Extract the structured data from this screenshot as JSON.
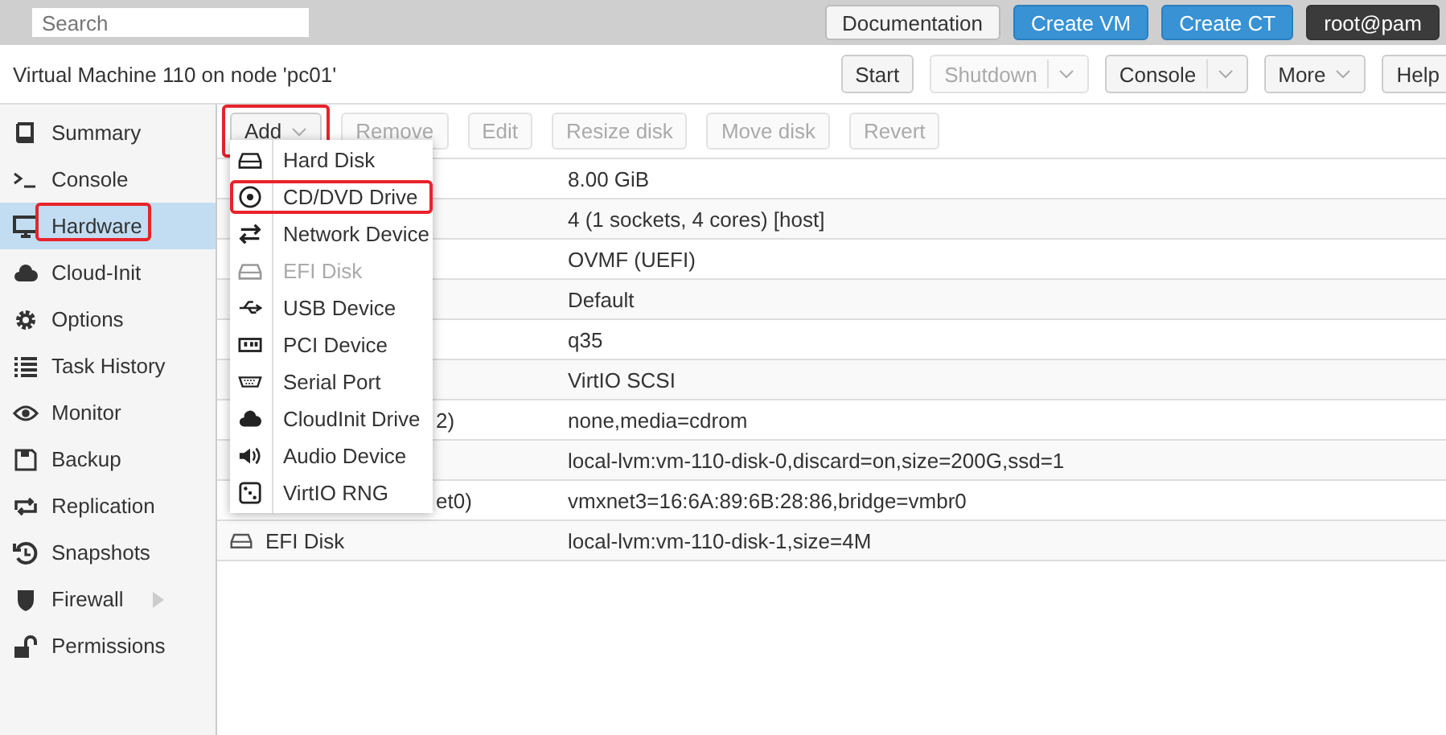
{
  "top_bar": {
    "search": {
      "placeholder": "Search"
    },
    "buttons": [
      {
        "label": "Documentation",
        "kind": "plain"
      },
      {
        "label": "Create VM",
        "kind": "primary"
      },
      {
        "label": "Create CT",
        "kind": "primary"
      },
      {
        "label": "root@pam",
        "kind": "user"
      }
    ]
  },
  "title": "Virtual Machine 110 on node 'pc01'",
  "header_buttons": [
    {
      "label": "Start",
      "disabled": false,
      "split": false,
      "caret": false
    },
    {
      "label": "Shutdown",
      "disabled": true,
      "split": true,
      "caret": true
    },
    {
      "label": "Console",
      "disabled": false,
      "split": true,
      "caret": true
    },
    {
      "label": "More",
      "disabled": false,
      "split": false,
      "caret": true
    },
    {
      "label": "Help",
      "disabled": false,
      "split": false,
      "caret": false
    }
  ],
  "sidebar": {
    "items": [
      {
        "label": "Summary",
        "selected": false,
        "annotated": false,
        "expandable": false
      },
      {
        "label": "Console",
        "selected": false,
        "annotated": false,
        "expandable": false
      },
      {
        "label": "Hardware",
        "selected": true,
        "annotated": true,
        "expandable": false
      },
      {
        "label": "Cloud-Init",
        "selected": false,
        "annotated": false,
        "expandable": false
      },
      {
        "label": "Options",
        "selected": false,
        "annotated": false,
        "expandable": false
      },
      {
        "label": "Task History",
        "selected": false,
        "annotated": false,
        "expandable": false
      },
      {
        "label": "Monitor",
        "selected": false,
        "annotated": false,
        "expandable": false
      },
      {
        "label": "Backup",
        "selected": false,
        "annotated": false,
        "expandable": false
      },
      {
        "label": "Replication",
        "selected": false,
        "annotated": false,
        "expandable": false
      },
      {
        "label": "Snapshots",
        "selected": false,
        "annotated": false,
        "expandable": false
      },
      {
        "label": "Firewall",
        "selected": false,
        "annotated": false,
        "expandable": true
      },
      {
        "label": "Permissions",
        "selected": false,
        "annotated": false,
        "expandable": false
      }
    ]
  },
  "toolbar": [
    {
      "label": "Add",
      "disabled": false,
      "caret": true,
      "annotated": true
    },
    {
      "label": "Remove",
      "disabled": true,
      "caret": false,
      "annotated": false
    },
    {
      "label": "Edit",
      "disabled": true,
      "caret": false,
      "annotated": false
    },
    {
      "label": "Resize disk",
      "disabled": true,
      "caret": false,
      "annotated": false
    },
    {
      "label": "Move disk",
      "disabled": true,
      "caret": false,
      "annotated": false
    },
    {
      "label": "Revert",
      "disabled": true,
      "caret": false,
      "annotated": false
    }
  ],
  "table": {
    "rows": [
      {
        "value": "8.00 GiB"
      },
      {
        "value": "4 (1 sockets, 4 cores) [host]"
      },
      {
        "value": "OVMF (UEFI)"
      },
      {
        "value": "Default"
      },
      {
        "value": "q35"
      },
      {
        "value": "VirtIO SCSI"
      },
      {
        "label": "2)",
        "kind": "cut",
        "value": "none,media=cdrom"
      },
      {
        "value": "local-lvm:vm-110-disk-0,discard=on,size=200G,ssd=1"
      },
      {
        "label": "et0)",
        "kind": "cut",
        "value": "vmxnet3=16:6A:89:6B:28:86,bridge=vmbr0"
      },
      {
        "label": "EFI Disk",
        "kind": "disk",
        "value": "local-lvm:vm-110-disk-1,size=4M"
      }
    ]
  },
  "add_menu": {
    "items": [
      {
        "label": "Hard Disk",
        "disabled": false,
        "annotated": false
      },
      {
        "label": "CD/DVD Drive",
        "disabled": false,
        "annotated": true
      },
      {
        "label": "Network Device",
        "disabled": false,
        "annotated": false
      },
      {
        "label": "EFI Disk",
        "disabled": true,
        "annotated": false
      },
      {
        "label": "USB Device",
        "disabled": false,
        "annotated": false
      },
      {
        "label": "PCI Device",
        "disabled": false,
        "annotated": false
      },
      {
        "label": "Serial Port",
        "disabled": false,
        "annotated": false
      },
      {
        "label": "CloudInit Drive",
        "disabled": false,
        "annotated": false
      },
      {
        "label": "Audio Device",
        "disabled": false,
        "annotated": false
      },
      {
        "label": "VirtIO RNG",
        "disabled": false,
        "annotated": false
      }
    ]
  }
}
